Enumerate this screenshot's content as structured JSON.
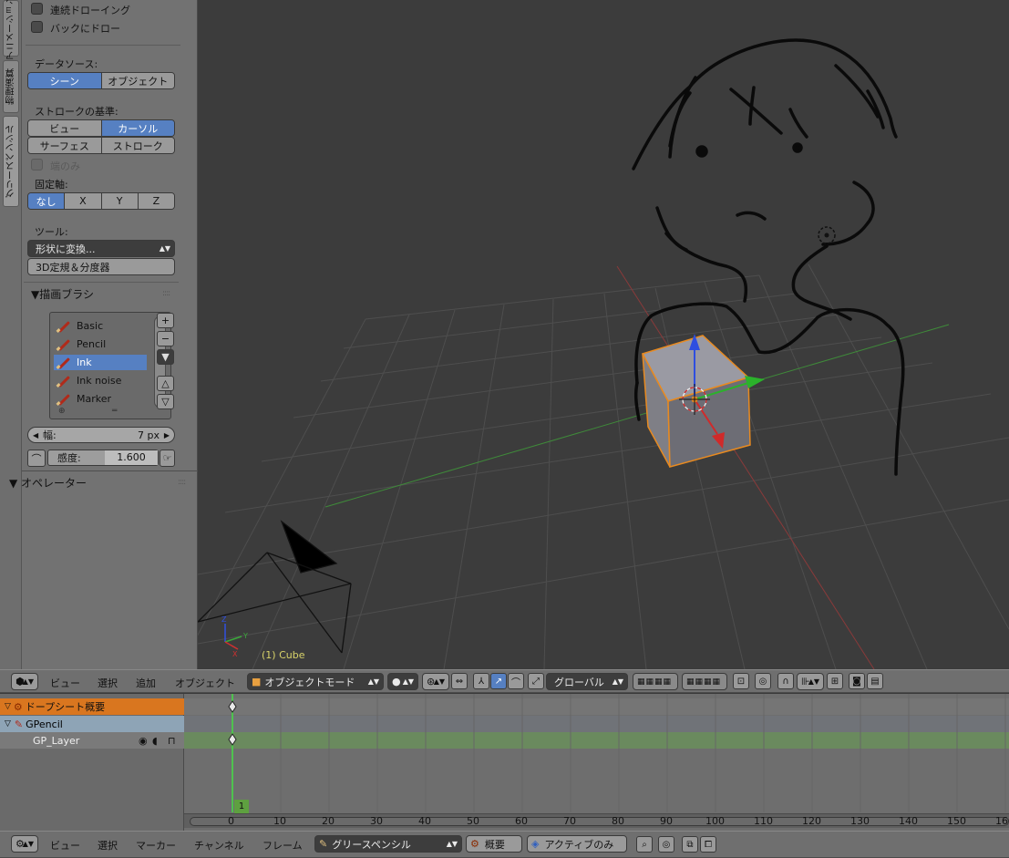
{
  "side_tabs": [
    "アニメーション",
    "物理演算",
    "グリースペンシル"
  ],
  "shelf": {
    "cont_draw": "連続ドローイング",
    "back_draw": "バックにドロー",
    "data_source_label": "データソース:",
    "data_source": [
      "シーン",
      "オブジェクト"
    ],
    "stroke_basis_label": "ストロークの基準:",
    "stroke_basis_row1": [
      "ビュー",
      "カーソル"
    ],
    "stroke_basis_row2": [
      "サーフェス",
      "ストローク"
    ],
    "ends_only": "端のみ",
    "lock_axis_label": "固定軸:",
    "lock_axis": [
      "なし",
      "X",
      "Y",
      "Z"
    ],
    "tools_label": "ツール:",
    "convert_btn": "形状に変換...",
    "ruler_btn": "3D定規＆分度器",
    "brush_panel": "▼描画ブラシ",
    "brushes": [
      "Basic",
      "Pencil",
      "Ink",
      "Ink noise",
      "Marker"
    ],
    "width_label": "幅:",
    "width_value": "7 px",
    "sensitivity_label": "感度:",
    "sensitivity_value": "1.600",
    "operator_panel": "▼ オペレーター"
  },
  "viewport": {
    "object_label": "(1) Cube"
  },
  "view3d_header": {
    "menus": [
      "ビュー",
      "選択",
      "追加",
      "オブジェクト"
    ],
    "mode": "オブジェクトモード",
    "orientation": "グローバル"
  },
  "dopesheet": {
    "channels": [
      "ドープシート概要",
      "GPencil",
      "GP_Layer"
    ],
    "current_frame": "1",
    "ticks": [
      "0",
      "10",
      "20",
      "30",
      "40",
      "50",
      "60",
      "70",
      "80",
      "90",
      "100",
      "110",
      "120",
      "130",
      "140",
      "150",
      "160"
    ]
  },
  "dopesheet_header": {
    "menus": [
      "ビュー",
      "選択",
      "マーカー",
      "チャンネル",
      "フレーム"
    ],
    "mode": "グリースペンシル",
    "summary": "概要",
    "active_only": "アクティブのみ"
  },
  "colors": {
    "selected_blue": "#5680c2",
    "header_orange": "#d9761f",
    "keyframe_green": "#5ea040",
    "viewport_bg": "#3c3c3c"
  }
}
